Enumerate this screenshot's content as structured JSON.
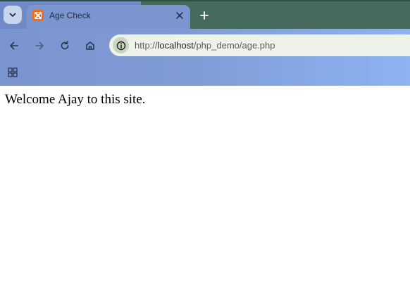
{
  "tab": {
    "title": "Age Check",
    "favicon": "xampp-icon"
  },
  "toolbar": {
    "url_scheme": "http://",
    "url_host": "localhost",
    "url_path": "/php_demo/age.php"
  },
  "page": {
    "text": "Welcome Ajay to this site."
  },
  "colors": {
    "tab_active": "#7b95cf",
    "tab_strip_left": "#6f8ac6",
    "tab_strip_right": "#466a5b",
    "omnibox_bg": "#eef2ea",
    "favicon": "#f26b1d"
  },
  "icons": [
    "chevron-down-icon",
    "close-icon",
    "plus-icon",
    "back-arrow-icon",
    "forward-arrow-icon",
    "reload-icon",
    "home-icon",
    "info-icon",
    "apps-grid-icon"
  ]
}
